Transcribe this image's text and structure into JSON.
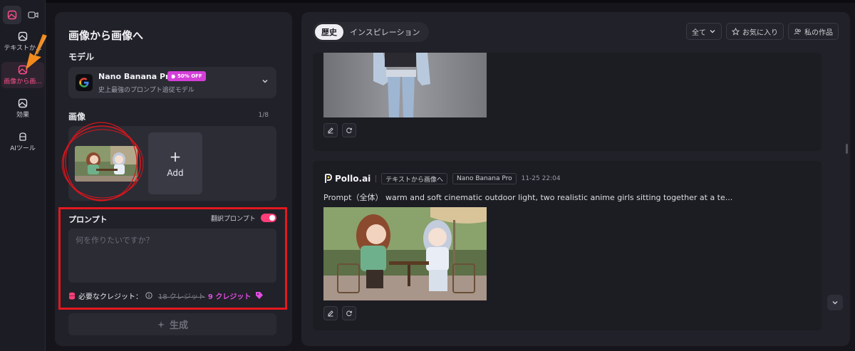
{
  "sidebar": {
    "items": [
      {
        "label": "テキストか...",
        "icon": "text-to-image-icon"
      },
      {
        "label": "画像から画...",
        "icon": "image-to-image-icon",
        "active": true
      },
      {
        "label": "効果",
        "icon": "effects-icon"
      },
      {
        "label": "AIツール",
        "icon": "ai-tools-icon"
      }
    ]
  },
  "panel": {
    "title": "画像から画像へ",
    "model_label": "モデル",
    "model": {
      "name": "Nano Banana Pro",
      "badge": "50% OFF",
      "description": "史上最強のプロンプト追従モデル"
    },
    "image_label": "画像",
    "image_count": "1/8",
    "add_label": "Add",
    "prompt_label": "プロンプト",
    "translate_label": "翻訳プロンプト",
    "translate_on": true,
    "prompt_placeholder": "何を作りたいですか？",
    "credit_label": "必要なクレジット：",
    "credit_old": "18 クレジット",
    "credit_new": "9 クレジット",
    "generate_label": "生成"
  },
  "history": {
    "tabs": [
      "歴史",
      "インスピレーション"
    ],
    "filter": "全て",
    "favorites": "お気に入り",
    "my_works": "私の作品",
    "entry": {
      "brand": "Pollo.ai",
      "mode": "テキストから画像へ",
      "model": "Nano Banana Pro",
      "timestamp": "11-25 22:04",
      "prompt": "Prompt（全体） warm and soft cinematic outdoor light, two realistic anime girls sitting together at a te..."
    }
  },
  "colors": {
    "accent": "#ff3d78",
    "badge": "#d43fd8",
    "annotation_red": "#e3181f",
    "arrow_orange": "#f28a1e"
  }
}
